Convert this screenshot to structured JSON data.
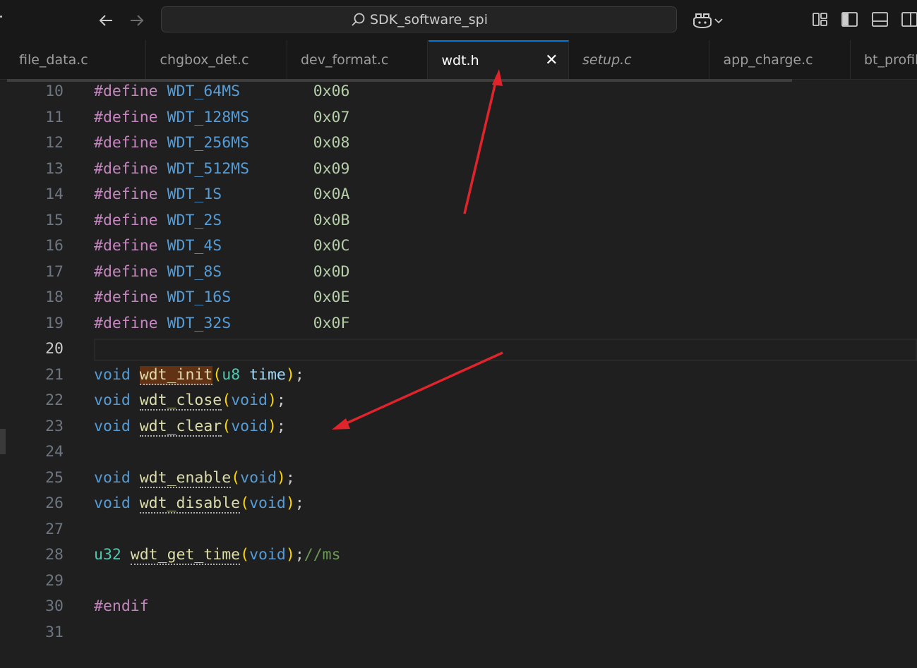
{
  "titlebar": {
    "search_text": "SDK_software_spi",
    "back_icon": "arrow-left-icon",
    "forward_icon": "arrow-right-icon",
    "search_icon": "search-icon",
    "copilot_icon": "copilot-icon",
    "copilot_chevron": "⌄"
  },
  "tabs": [
    {
      "label": "file_data.c",
      "italic": false,
      "active": false
    },
    {
      "label": "chgbox_det.c",
      "italic": false,
      "active": false
    },
    {
      "label": "dev_format.c",
      "italic": false,
      "active": false
    },
    {
      "label": "wdt.h",
      "italic": false,
      "active": true,
      "close": "✕"
    },
    {
      "label": "setup.c",
      "italic": true,
      "active": false
    },
    {
      "label": "app_charge.c",
      "italic": false,
      "active": false
    },
    {
      "label": "bt_profil",
      "italic": false,
      "active": false
    }
  ],
  "editor": {
    "current_line": "20",
    "lines": [
      {
        "n": "10",
        "tokens": [
          [
            "kw-def",
            "#define"
          ],
          [
            "punc",
            " "
          ],
          [
            "macro",
            "WDT_64MS"
          ],
          [
            "punc",
            "        "
          ],
          [
            "num",
            "0x06"
          ]
        ]
      },
      {
        "n": "11",
        "tokens": [
          [
            "kw-def",
            "#define"
          ],
          [
            "punc",
            " "
          ],
          [
            "macro",
            "WDT_128MS"
          ],
          [
            "punc",
            "       "
          ],
          [
            "num",
            "0x07"
          ]
        ]
      },
      {
        "n": "12",
        "tokens": [
          [
            "kw-def",
            "#define"
          ],
          [
            "punc",
            " "
          ],
          [
            "macro",
            "WDT_256MS"
          ],
          [
            "punc",
            "       "
          ],
          [
            "num",
            "0x08"
          ]
        ]
      },
      {
        "n": "13",
        "tokens": [
          [
            "kw-def",
            "#define"
          ],
          [
            "punc",
            " "
          ],
          [
            "macro",
            "WDT_512MS"
          ],
          [
            "punc",
            "       "
          ],
          [
            "num",
            "0x09"
          ]
        ]
      },
      {
        "n": "14",
        "tokens": [
          [
            "kw-def",
            "#define"
          ],
          [
            "punc",
            " "
          ],
          [
            "macro",
            "WDT_1S"
          ],
          [
            "punc",
            "          "
          ],
          [
            "num",
            "0x0A"
          ]
        ]
      },
      {
        "n": "15",
        "tokens": [
          [
            "kw-def",
            "#define"
          ],
          [
            "punc",
            " "
          ],
          [
            "macro",
            "WDT_2S"
          ],
          [
            "punc",
            "          "
          ],
          [
            "num",
            "0x0B"
          ]
        ]
      },
      {
        "n": "16",
        "tokens": [
          [
            "kw-def",
            "#define"
          ],
          [
            "punc",
            " "
          ],
          [
            "macro",
            "WDT_4S"
          ],
          [
            "punc",
            "          "
          ],
          [
            "num",
            "0x0C"
          ]
        ]
      },
      {
        "n": "17",
        "tokens": [
          [
            "kw-def",
            "#define"
          ],
          [
            "punc",
            " "
          ],
          [
            "macro",
            "WDT_8S"
          ],
          [
            "punc",
            "          "
          ],
          [
            "num",
            "0x0D"
          ]
        ]
      },
      {
        "n": "18",
        "tokens": [
          [
            "kw-def",
            "#define"
          ],
          [
            "punc",
            " "
          ],
          [
            "macro",
            "WDT_16S"
          ],
          [
            "punc",
            "         "
          ],
          [
            "num",
            "0x0E"
          ]
        ]
      },
      {
        "n": "19",
        "tokens": [
          [
            "kw-def",
            "#define"
          ],
          [
            "punc",
            " "
          ],
          [
            "macro",
            "WDT_32S"
          ],
          [
            "punc",
            "         "
          ],
          [
            "num",
            "0x0F"
          ]
        ]
      },
      {
        "n": "20",
        "tokens": []
      },
      {
        "n": "21",
        "tokens": [
          [
            "kw",
            "void"
          ],
          [
            "punc",
            " "
          ],
          [
            "fn hl squig",
            "wdt_init"
          ],
          [
            "paren",
            "("
          ],
          [
            "ty",
            "u8"
          ],
          [
            "punc",
            " "
          ],
          [
            "param",
            "time"
          ],
          [
            "paren",
            ")"
          ],
          [
            "punc",
            ";"
          ]
        ]
      },
      {
        "n": "22",
        "tokens": [
          [
            "kw",
            "void"
          ],
          [
            "punc",
            " "
          ],
          [
            "fn squig",
            "wdt_close"
          ],
          [
            "paren",
            "("
          ],
          [
            "kw",
            "void"
          ],
          [
            "paren",
            ")"
          ],
          [
            "punc",
            ";"
          ]
        ]
      },
      {
        "n": "23",
        "tokens": [
          [
            "kw",
            "void"
          ],
          [
            "punc",
            " "
          ],
          [
            "fn squig",
            "wdt_clear"
          ],
          [
            "paren",
            "("
          ],
          [
            "kw",
            "void"
          ],
          [
            "paren",
            ")"
          ],
          [
            "punc",
            ";"
          ]
        ]
      },
      {
        "n": "24",
        "tokens": []
      },
      {
        "n": "25",
        "tokens": [
          [
            "kw",
            "void"
          ],
          [
            "punc",
            " "
          ],
          [
            "fn squig",
            "wdt_enable"
          ],
          [
            "paren",
            "("
          ],
          [
            "kw",
            "void"
          ],
          [
            "paren",
            ")"
          ],
          [
            "punc",
            ";"
          ]
        ]
      },
      {
        "n": "26",
        "tokens": [
          [
            "kw",
            "void"
          ],
          [
            "punc",
            " "
          ],
          [
            "fn squig",
            "wdt_disable"
          ],
          [
            "paren",
            "("
          ],
          [
            "kw",
            "void"
          ],
          [
            "paren",
            ")"
          ],
          [
            "punc",
            ";"
          ]
        ]
      },
      {
        "n": "27",
        "tokens": []
      },
      {
        "n": "28",
        "tokens": [
          [
            "ty",
            "u32"
          ],
          [
            "punc",
            " "
          ],
          [
            "fn squig",
            "wdt_get_time"
          ],
          [
            "paren",
            "("
          ],
          [
            "kw",
            "void"
          ],
          [
            "paren",
            ")"
          ],
          [
            "punc",
            ";"
          ],
          [
            "cmt",
            "//ms"
          ]
        ]
      },
      {
        "n": "29",
        "tokens": []
      },
      {
        "n": "30",
        "tokens": [
          [
            "kw-def",
            "#endif"
          ]
        ]
      },
      {
        "n": "31",
        "tokens": []
      }
    ]
  },
  "annotations": {
    "arrow_color": "#e0242b"
  }
}
